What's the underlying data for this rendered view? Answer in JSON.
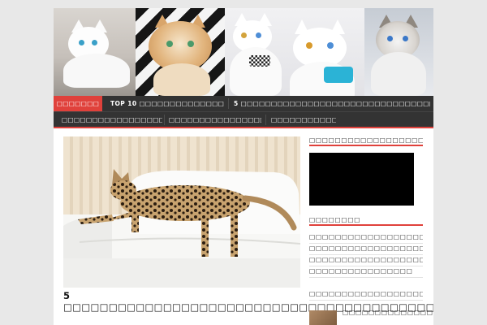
{
  "nav": {
    "row1": [
      {
        "label": "□□□□□□□",
        "active": true
      },
      {
        "label": "TOP 10 □□□□□□□□□□□□□□□□□□□□□□□□□□",
        "active": false
      },
      {
        "label": "5 □□□□□□□□□□□□□□□□□□□□□□□□□□□□□□□□□□□□□□□□□□",
        "active": false
      }
    ],
    "row2": [
      {
        "label": "□□□□□□□□□□□□□□□□□□□□□□□□□"
      },
      {
        "label": "□□□□□□□□□□□□□□□□□□□□□□"
      },
      {
        "label": "□□□□□□□□□□□□□□"
      }
    ]
  },
  "post": {
    "title": "5 □□□□□□□□□□□□□□□□□□□□□□□□□□□□□□□□□□□□□□□□□□□□□□□□□□□□□□□□□□□□□□□□□□□□"
  },
  "sidebar": {
    "video_heading": "□□□□□□□□□□□□□□□□□□",
    "links_heading": "□□□□□□□□",
    "links": [
      "□□□□□□□□□□□□□□□□□□",
      "□□□□□□□□□□□□□□□□□□□□□□",
      "□□□□□□□□□□□□□□□□□□□",
      "□□□□□□□□□□□□□□□□",
      "□□□□□□□□□□□□□□□□□□□□□□"
    ],
    "recent_post_title": "□□□□□□□□□□□□□□□□□□□□□□□□"
  },
  "colors": {
    "accent": "#e0413b",
    "nav_bg": "#333333",
    "page_bg": "#e8e8e8"
  }
}
